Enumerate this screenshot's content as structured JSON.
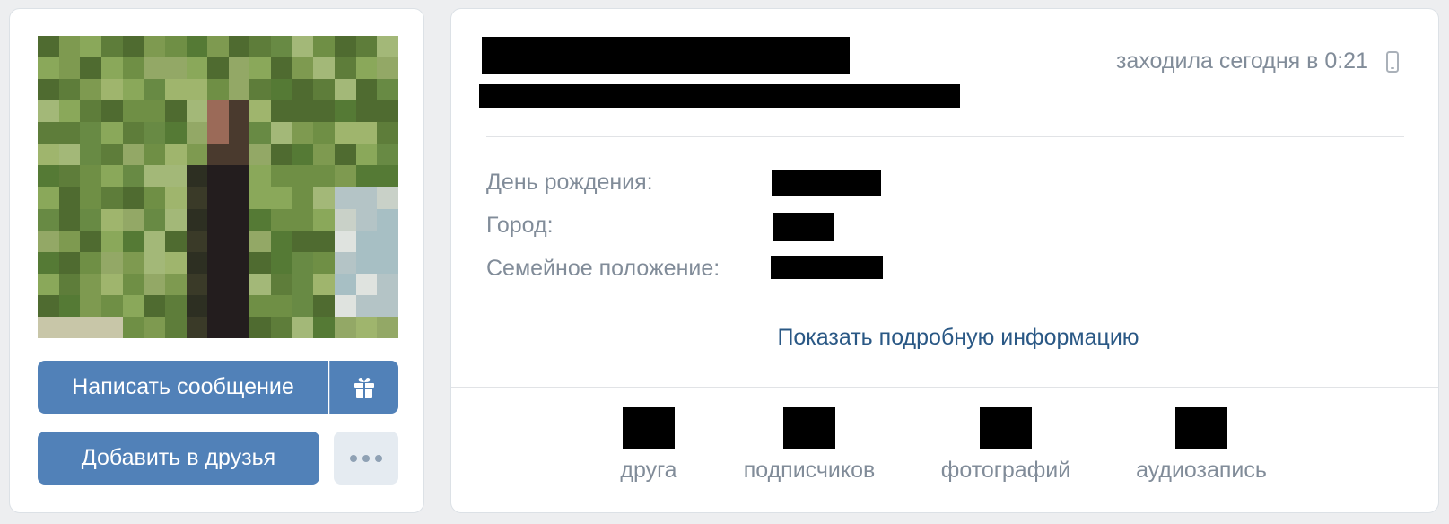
{
  "profile": {
    "last_seen": "заходила сегодня в 0:21",
    "device_icon": "phone-icon"
  },
  "actions": {
    "message_label": "Написать сообщение",
    "gift_icon": "gift-icon",
    "add_friend_label": "Добавить в друзья",
    "more_icon": "more-dots-icon"
  },
  "info": {
    "rows": [
      {
        "label": "День рождения:"
      },
      {
        "label": "Город:"
      },
      {
        "label": "Семейное положение:"
      }
    ],
    "show_more_link": "Показать подробную информацию"
  },
  "counters": [
    {
      "label": "друга"
    },
    {
      "label": "подписчиков"
    },
    {
      "label": "фотографий"
    },
    {
      "label": "аудиозапись"
    }
  ],
  "colors": {
    "accent": "#5181b8",
    "link": "#2a5885",
    "secondary_text": "#818c99",
    "background": "#edeef0"
  }
}
